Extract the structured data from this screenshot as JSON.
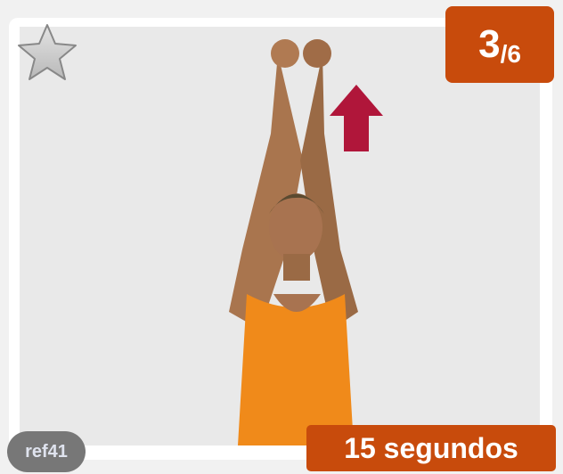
{
  "exercise": {
    "step": "3",
    "total": "/6",
    "reference": "ref41",
    "duration": "15 segundos"
  },
  "colors": {
    "badge": "#c84b0c",
    "ref_badge": "#777777",
    "arrow": "#b0163a",
    "shirt": "#f08a1a"
  },
  "icons": {
    "favorite": "star-outline-icon",
    "direction": "arrow-up-icon"
  }
}
